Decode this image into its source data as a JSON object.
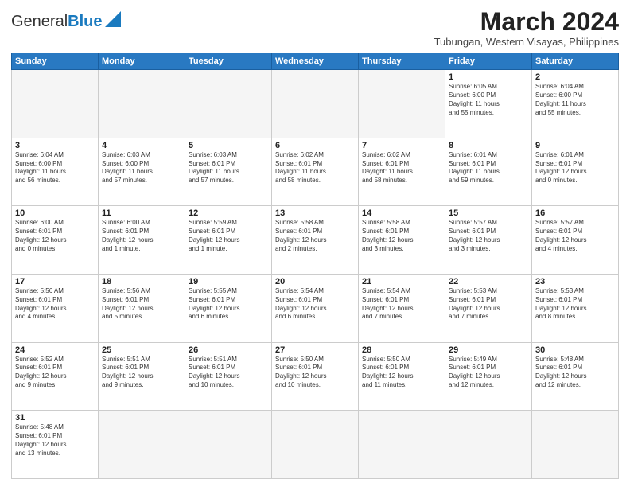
{
  "header": {
    "logo_general": "General",
    "logo_blue": "Blue",
    "month_year": "March 2024",
    "location": "Tubungan, Western Visayas, Philippines"
  },
  "weekdays": [
    "Sunday",
    "Monday",
    "Tuesday",
    "Wednesday",
    "Thursday",
    "Friday",
    "Saturday"
  ],
  "weeks": [
    [
      {
        "day": "",
        "info": ""
      },
      {
        "day": "",
        "info": ""
      },
      {
        "day": "",
        "info": ""
      },
      {
        "day": "",
        "info": ""
      },
      {
        "day": "",
        "info": ""
      },
      {
        "day": "1",
        "info": "Sunrise: 6:05 AM\nSunset: 6:00 PM\nDaylight: 11 hours\nand 55 minutes."
      },
      {
        "day": "2",
        "info": "Sunrise: 6:04 AM\nSunset: 6:00 PM\nDaylight: 11 hours\nand 55 minutes."
      }
    ],
    [
      {
        "day": "3",
        "info": "Sunrise: 6:04 AM\nSunset: 6:00 PM\nDaylight: 11 hours\nand 56 minutes."
      },
      {
        "day": "4",
        "info": "Sunrise: 6:03 AM\nSunset: 6:00 PM\nDaylight: 11 hours\nand 57 minutes."
      },
      {
        "day": "5",
        "info": "Sunrise: 6:03 AM\nSunset: 6:01 PM\nDaylight: 11 hours\nand 57 minutes."
      },
      {
        "day": "6",
        "info": "Sunrise: 6:02 AM\nSunset: 6:01 PM\nDaylight: 11 hours\nand 58 minutes."
      },
      {
        "day": "7",
        "info": "Sunrise: 6:02 AM\nSunset: 6:01 PM\nDaylight: 11 hours\nand 58 minutes."
      },
      {
        "day": "8",
        "info": "Sunrise: 6:01 AM\nSunset: 6:01 PM\nDaylight: 11 hours\nand 59 minutes."
      },
      {
        "day": "9",
        "info": "Sunrise: 6:01 AM\nSunset: 6:01 PM\nDaylight: 12 hours\nand 0 minutes."
      }
    ],
    [
      {
        "day": "10",
        "info": "Sunrise: 6:00 AM\nSunset: 6:01 PM\nDaylight: 12 hours\nand 0 minutes."
      },
      {
        "day": "11",
        "info": "Sunrise: 6:00 AM\nSunset: 6:01 PM\nDaylight: 12 hours\nand 1 minute."
      },
      {
        "day": "12",
        "info": "Sunrise: 5:59 AM\nSunset: 6:01 PM\nDaylight: 12 hours\nand 1 minute."
      },
      {
        "day": "13",
        "info": "Sunrise: 5:58 AM\nSunset: 6:01 PM\nDaylight: 12 hours\nand 2 minutes."
      },
      {
        "day": "14",
        "info": "Sunrise: 5:58 AM\nSunset: 6:01 PM\nDaylight: 12 hours\nand 3 minutes."
      },
      {
        "day": "15",
        "info": "Sunrise: 5:57 AM\nSunset: 6:01 PM\nDaylight: 12 hours\nand 3 minutes."
      },
      {
        "day": "16",
        "info": "Sunrise: 5:57 AM\nSunset: 6:01 PM\nDaylight: 12 hours\nand 4 minutes."
      }
    ],
    [
      {
        "day": "17",
        "info": "Sunrise: 5:56 AM\nSunset: 6:01 PM\nDaylight: 12 hours\nand 4 minutes."
      },
      {
        "day": "18",
        "info": "Sunrise: 5:56 AM\nSunset: 6:01 PM\nDaylight: 12 hours\nand 5 minutes."
      },
      {
        "day": "19",
        "info": "Sunrise: 5:55 AM\nSunset: 6:01 PM\nDaylight: 12 hours\nand 6 minutes."
      },
      {
        "day": "20",
        "info": "Sunrise: 5:54 AM\nSunset: 6:01 PM\nDaylight: 12 hours\nand 6 minutes."
      },
      {
        "day": "21",
        "info": "Sunrise: 5:54 AM\nSunset: 6:01 PM\nDaylight: 12 hours\nand 7 minutes."
      },
      {
        "day": "22",
        "info": "Sunrise: 5:53 AM\nSunset: 6:01 PM\nDaylight: 12 hours\nand 7 minutes."
      },
      {
        "day": "23",
        "info": "Sunrise: 5:53 AM\nSunset: 6:01 PM\nDaylight: 12 hours\nand 8 minutes."
      }
    ],
    [
      {
        "day": "24",
        "info": "Sunrise: 5:52 AM\nSunset: 6:01 PM\nDaylight: 12 hours\nand 9 minutes."
      },
      {
        "day": "25",
        "info": "Sunrise: 5:51 AM\nSunset: 6:01 PM\nDaylight: 12 hours\nand 9 minutes."
      },
      {
        "day": "26",
        "info": "Sunrise: 5:51 AM\nSunset: 6:01 PM\nDaylight: 12 hours\nand 10 minutes."
      },
      {
        "day": "27",
        "info": "Sunrise: 5:50 AM\nSunset: 6:01 PM\nDaylight: 12 hours\nand 10 minutes."
      },
      {
        "day": "28",
        "info": "Sunrise: 5:50 AM\nSunset: 6:01 PM\nDaylight: 12 hours\nand 11 minutes."
      },
      {
        "day": "29",
        "info": "Sunrise: 5:49 AM\nSunset: 6:01 PM\nDaylight: 12 hours\nand 12 minutes."
      },
      {
        "day": "30",
        "info": "Sunrise: 5:48 AM\nSunset: 6:01 PM\nDaylight: 12 hours\nand 12 minutes."
      }
    ],
    [
      {
        "day": "31",
        "info": "Sunrise: 5:48 AM\nSunset: 6:01 PM\nDaylight: 12 hours\nand 13 minutes."
      },
      {
        "day": "",
        "info": ""
      },
      {
        "day": "",
        "info": ""
      },
      {
        "day": "",
        "info": ""
      },
      {
        "day": "",
        "info": ""
      },
      {
        "day": "",
        "info": ""
      },
      {
        "day": "",
        "info": ""
      }
    ]
  ]
}
